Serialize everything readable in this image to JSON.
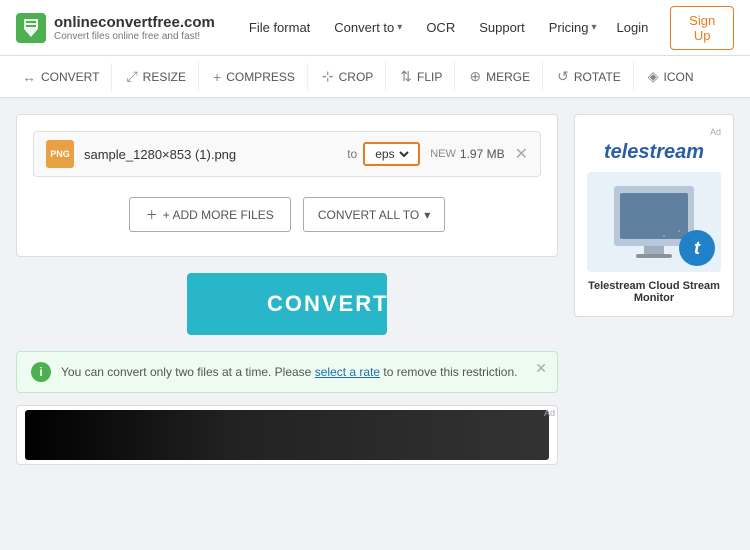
{
  "site": {
    "name": "onlineconvertfree.com",
    "tagline": "Convert files online free and fast!"
  },
  "nav": {
    "items": [
      {
        "label": "File format",
        "has_arrow": false
      },
      {
        "label": "Convert to",
        "has_arrow": true
      },
      {
        "label": "OCR",
        "has_arrow": false
      },
      {
        "label": "Support",
        "has_arrow": false
      },
      {
        "label": "Pricing",
        "has_arrow": true
      }
    ],
    "login": "Login",
    "signup": "Sign Up"
  },
  "toolbar": {
    "items": [
      {
        "label": "CONVERT",
        "icon": "↔"
      },
      {
        "label": "RESIZE",
        "icon": "⤢"
      },
      {
        "label": "COMPRESS",
        "icon": "+"
      },
      {
        "label": "CROP",
        "icon": "⊹"
      },
      {
        "label": "FLIP",
        "icon": "⇅"
      },
      {
        "label": "MERGE",
        "icon": "⊕"
      },
      {
        "label": "ROTATE",
        "icon": "↺"
      },
      {
        "label": "ICON",
        "icon": "◈"
      }
    ]
  },
  "file_row": {
    "file_type": "PNG",
    "file_name": "sample_1280×853 (1).png",
    "to_label": "to",
    "format_value": "eps",
    "new_label": "NEW",
    "file_size": "1.97 MB"
  },
  "actions": {
    "add_files": "+ ADD MORE FILES",
    "convert_all": "CONVERT ALL TO",
    "convert": "CONVERT"
  },
  "notice": {
    "text": "You can convert only two files at a time. Please",
    "link_text": "select a rate",
    "text_after": "to remove this restriction."
  },
  "ad": {
    "label": "Ad",
    "brand": "telestream",
    "title": "Telestream Cloud Stream Monitor"
  }
}
